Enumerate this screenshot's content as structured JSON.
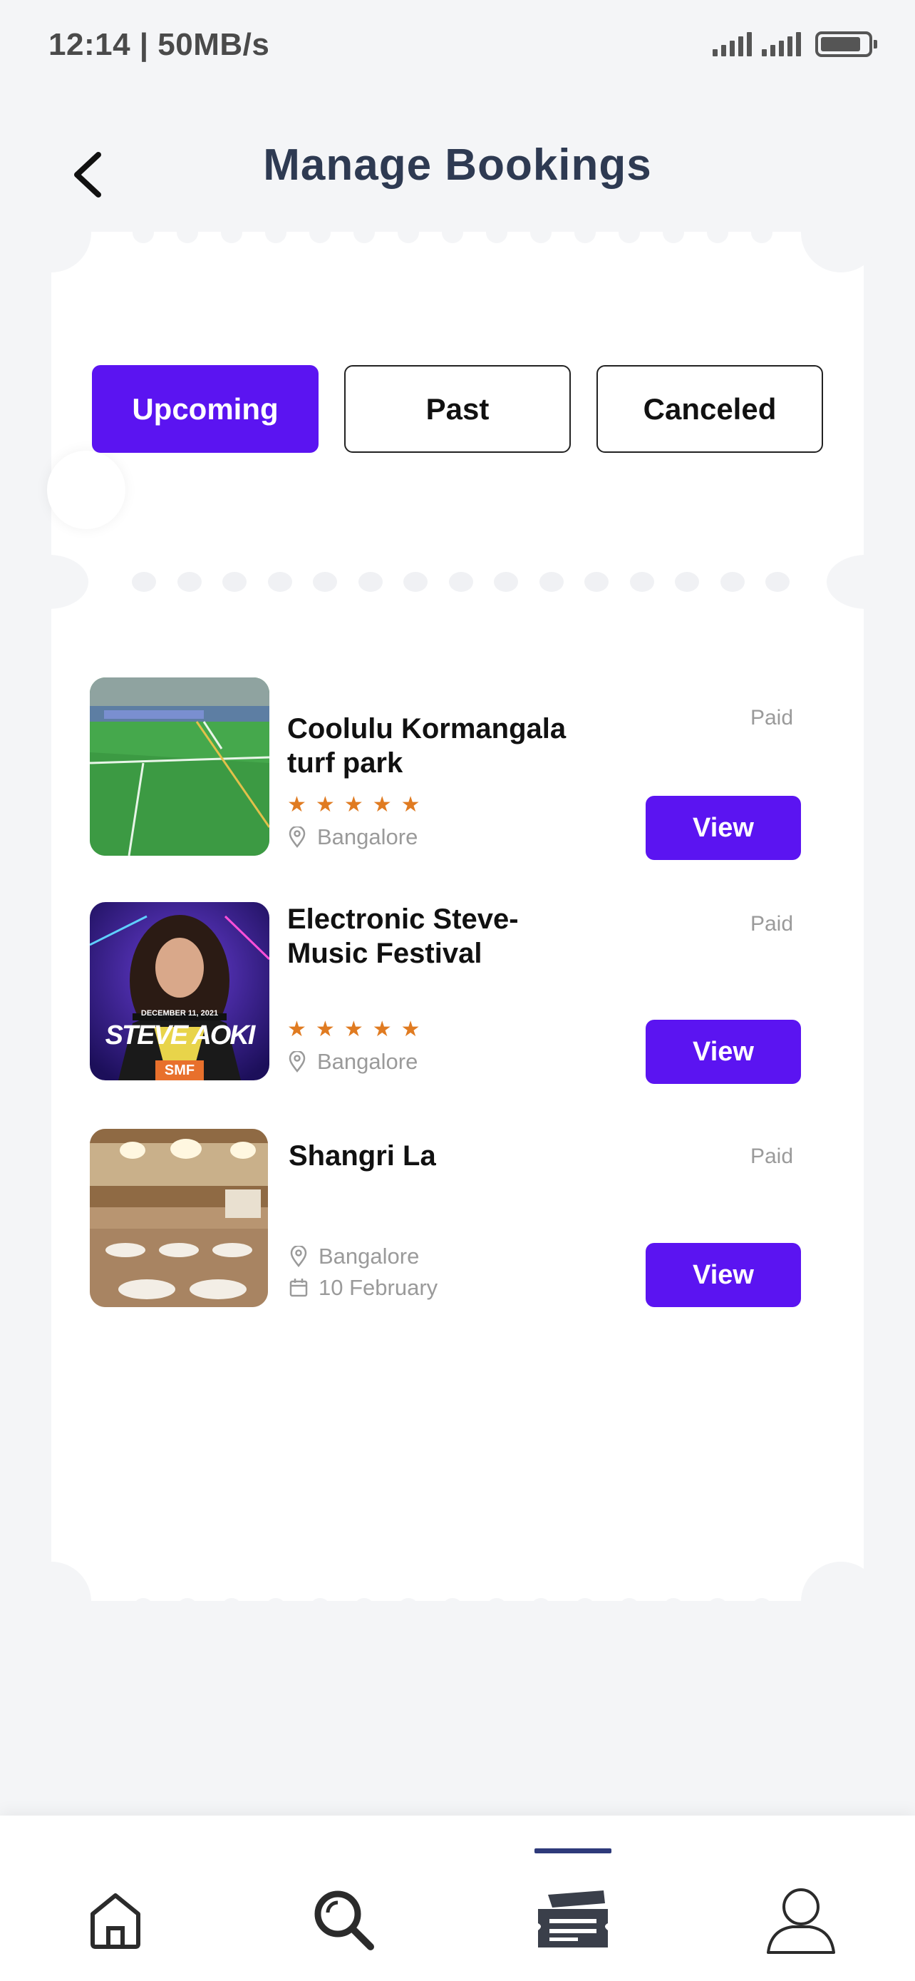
{
  "status_bar": {
    "time": "12:14 | 50MB/s"
  },
  "header": {
    "title": "Manage Bookings"
  },
  "tabs": [
    {
      "label": "Upcoming",
      "active": true
    },
    {
      "label": "Past",
      "active": false
    },
    {
      "label": "Canceled",
      "active": false
    }
  ],
  "bookings": [
    {
      "title_line1": "Coolulu Kormangala",
      "title_line2": "turf park",
      "rating": 5,
      "location": "Bangalore",
      "status": "Paid",
      "action": "View"
    },
    {
      "title_line1": "Electronic Steve-",
      "title_line2": "Music Festival",
      "rating": 5,
      "location": "Bangalore",
      "status": "Paid",
      "action": "View",
      "poster_text": "STEVE AOKI",
      "poster_date": "DECEMBER 11, 2021",
      "poster_badge": "SMF"
    },
    {
      "title_line1": "Shangri La",
      "location": "Bangalore",
      "date": "10 February",
      "status": "Paid",
      "action": "View"
    }
  ],
  "bottom_nav": [
    {
      "icon": "home-icon"
    },
    {
      "icon": "search-icon"
    },
    {
      "icon": "ticket-icon",
      "active": true
    },
    {
      "icon": "profile-icon"
    }
  ],
  "colors": {
    "accent": "#5b14f1",
    "title": "#2e3a52",
    "star": "#e07b21",
    "background": "#f4f5f7"
  }
}
